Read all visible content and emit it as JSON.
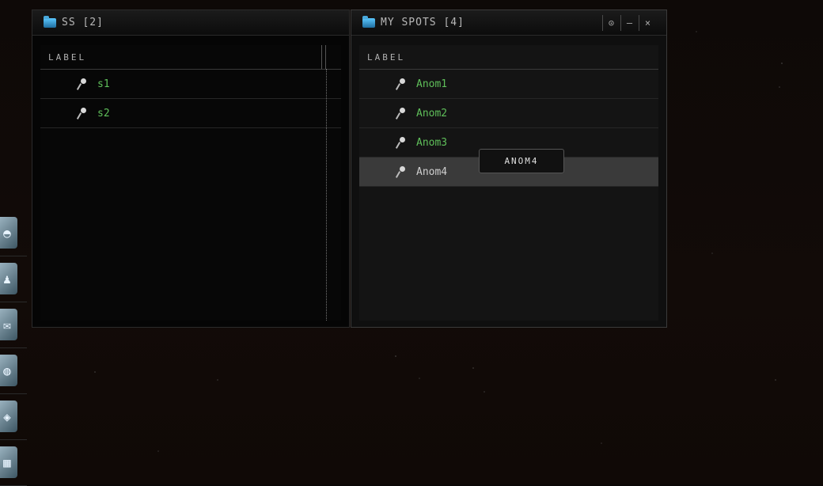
{
  "left_panel": {
    "title": "SS [2]",
    "column_header": "LABEL",
    "rows": [
      {
        "label": "s1"
      },
      {
        "label": "s2"
      }
    ]
  },
  "right_panel": {
    "title": "MY SPOTS [4]",
    "column_header": "LABEL",
    "controls": {
      "settings_glyph": "⊙",
      "minimize_glyph": "–",
      "close_glyph": "×"
    },
    "rows": [
      {
        "label": "Anom1"
      },
      {
        "label": "Anom2"
      },
      {
        "label": "Anom3"
      },
      {
        "label": "Anom4"
      }
    ],
    "selected_index": 3
  },
  "tooltip": {
    "text": "ANOM4"
  },
  "dock_icons": [
    "helmet-icon",
    "figure-icon",
    "envelope-icon",
    "planet-icon",
    "scanner-icon",
    "map-icon"
  ],
  "colors": {
    "bookmark_green": "#5fbf5a",
    "selected_row": "#3a3a3a",
    "folder_blue": "#5cc8ff"
  }
}
